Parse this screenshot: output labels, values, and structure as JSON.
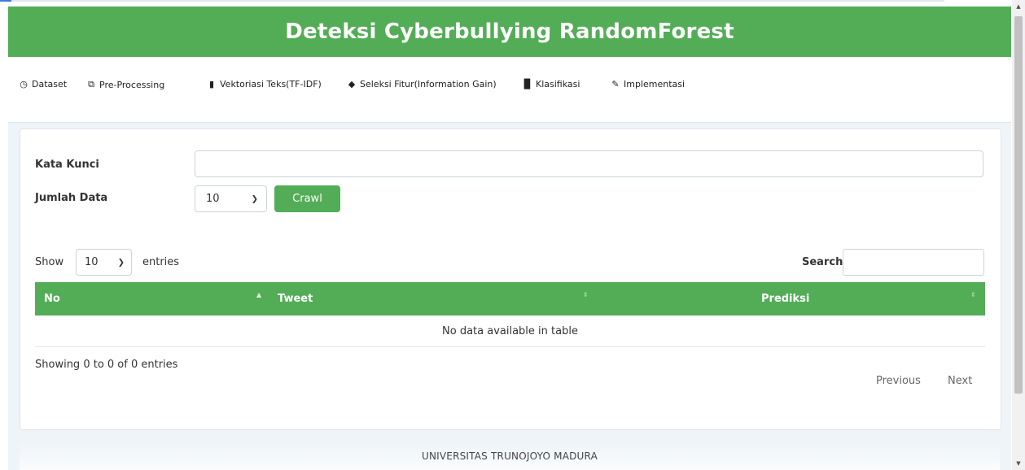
{
  "app": {
    "title": "Deteksi Cyberbullying RandomForest"
  },
  "nav": {
    "items": [
      {
        "label": "Dataset",
        "icon": "clock-icon"
      },
      {
        "label": "Pre-Processing",
        "icon": "copy-icon"
      },
      {
        "label": "Vektoriasi Teks(TF-IDF)",
        "icon": "file-icon"
      },
      {
        "label": "Seleksi Fitur(Information Gain)",
        "icon": "tag-icon"
      },
      {
        "label": "Klasifikasi",
        "icon": "bar-chart-icon"
      },
      {
        "label": "Implementasi",
        "icon": "pencil-icon"
      }
    ]
  },
  "form": {
    "keyword_label": "Kata Kunci",
    "keyword_value": "",
    "count_label": "Jumlah Data",
    "count_value": "10",
    "crawl_button": "Crawl"
  },
  "table": {
    "show_label": "Show",
    "length_value": "10",
    "entries_label": "entries",
    "search_label": "Search:",
    "search_value": "",
    "columns": [
      "No",
      "Tweet",
      "Prediksi"
    ],
    "empty_message": "No data available in table",
    "info": "Showing 0 to 0 of 0 entries",
    "prev_label": "Previous",
    "next_label": "Next"
  },
  "footer": {
    "text": "UNIVERSITAS TRUNOJOYO MADURA"
  },
  "colors": {
    "accent": "#53ad56",
    "background": "#eef4f8"
  }
}
